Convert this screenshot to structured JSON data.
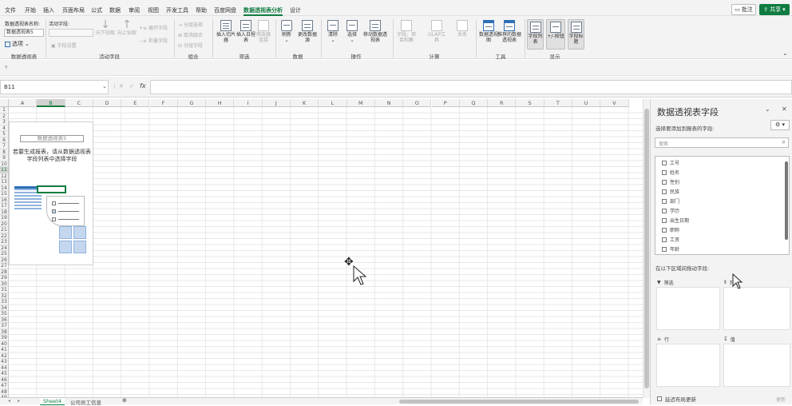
{
  "menu": {
    "tabs": [
      "文件",
      "开始",
      "插入",
      "页面布局",
      "公式",
      "数据",
      "审阅",
      "视图",
      "开发工具",
      "帮助",
      "百度网盘",
      "数据透视表分析",
      "设计"
    ],
    "active": "数据透视表分析",
    "comment_label": "批注",
    "share_label": "共享"
  },
  "ribbon": {
    "pt_name_label": "数据透视表名称:",
    "pt_name_value": "数据透视表5",
    "options_label": "选项",
    "active_field_label": "活动字段:",
    "field_settings_label": "字段设置",
    "drill_down_label": "向下钻取",
    "drill_up_label": "向上钻取",
    "expand_label": "展开字段",
    "collapse_label": "折叠字段",
    "group_sel_label": "分组选择",
    "ungroup_label": "取消组合",
    "group_field_label": "分组字段",
    "slicer_label": "插入切片器",
    "timeline_label": "插入日程表",
    "filter_conn_label": "筛选器连接",
    "refresh_label": "刷新",
    "change_source_label": "更改数据源",
    "clear_label": "清除",
    "select_label": "选择",
    "move_label": "移动数据透视表",
    "fields_items_label": "字段、项目和集",
    "olap_label": "OLAP工具",
    "relations_label": "关系",
    "pivotchart_label": "数据透视图",
    "recommended_label": "推荐的数据透视表",
    "field_list_label": "字段列表",
    "buttons_label": "+/-按钮",
    "headers_label": "字段标题",
    "groups": [
      "数据透视表",
      "活动字段",
      "组合",
      "筛选",
      "数据",
      "操作",
      "计算",
      "工具",
      "显示"
    ]
  },
  "formula": {
    "name_box": "B11",
    "fx": "fx",
    "value": ""
  },
  "sheet": {
    "columns": [
      "A",
      "B",
      "C",
      "D",
      "E",
      "F",
      "G",
      "H",
      "I",
      "J",
      "K",
      "L",
      "M",
      "N",
      "O",
      "P",
      "Q",
      "R",
      "S",
      "T",
      "U",
      "V"
    ],
    "rows": [
      "1",
      "2",
      "3",
      "4",
      "5",
      "6",
      "7",
      "8",
      "9",
      "10",
      "11",
      "12",
      "13",
      "14",
      "15",
      "16",
      "17",
      "18",
      "19",
      "20",
      "21",
      "22",
      "23",
      "24",
      "25",
      "26",
      "27",
      "28",
      "29",
      "30",
      "31",
      "32",
      "33",
      "34",
      "35",
      "36",
      "37",
      "38",
      "39",
      "40",
      "41",
      "42",
      "43",
      "44",
      "45",
      "46",
      "47",
      "48",
      "49",
      "50"
    ],
    "pt_title": "数据透视表5",
    "pt_hint": "若要生成报表，请从数据透视表字段列表中选择字段",
    "tabs": [
      "Sheet4",
      "公司员工信息"
    ],
    "active_tab": "Sheet4"
  },
  "pane": {
    "title": "数据透视表字段",
    "subtitle": "选择要添加到报表的字段:",
    "search_placeholder": "搜索",
    "fields": [
      "工号",
      "姓名",
      "性别",
      "民族",
      "部门",
      "学历",
      "出生日期",
      "职称",
      "工资",
      "年龄"
    ],
    "drag_hint": "在以下区域间拖动字段:",
    "filters_label": "筛选",
    "columns_label": "列",
    "rows_label": "行",
    "values_label": "值",
    "defer_label": "延迟布局更新",
    "update_label": "更新"
  },
  "colors": {
    "accent": "#107c41",
    "table_blue": "#2f6fb6"
  }
}
